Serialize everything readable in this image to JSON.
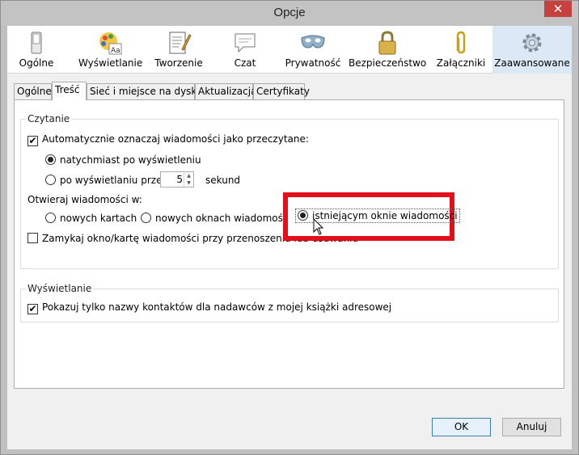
{
  "window": {
    "title": "Opcje",
    "close_glyph": "✕"
  },
  "toolbar": {
    "items": [
      {
        "label": "Ogólne",
        "icon": "switch-icon"
      },
      {
        "label": "Wyświetlanie",
        "icon": "palette-icon"
      },
      {
        "label": "Tworzenie",
        "icon": "compose-icon"
      },
      {
        "label": "Czat",
        "icon": "chat-bubble-icon"
      },
      {
        "label": "Prywatność",
        "icon": "mask-icon"
      },
      {
        "label": "Bezpieczeństwo",
        "icon": "padlock-icon"
      },
      {
        "label": "Załączniki",
        "icon": "paperclip-icon"
      },
      {
        "label": "Zaawansowane",
        "icon": "gear-icon"
      }
    ],
    "selected": "Zaawansowane"
  },
  "tabs": [
    "Ogólne",
    "Treść",
    "Sieć i miejsce na dysku",
    "Aktualizacja",
    "Certyfikaty"
  ],
  "active_tab": "Treść",
  "czytanie": {
    "title": "Czytanie",
    "auto_mark": {
      "label": "Automatycznie oznaczaj wiadomości jako przeczytane:",
      "checked": true
    },
    "immediately": {
      "label": "natychmiast po wyświetleniu",
      "selected": true
    },
    "after_display": {
      "label": "po wyświetlaniu przez",
      "selected": false
    },
    "seconds_value": "5",
    "seconds_unit": "sekund",
    "open_in": {
      "label": "Otwieraj wiadomości w:"
    },
    "new_tabs": {
      "label": "nowych kartach",
      "selected": false
    },
    "new_windows": {
      "label": "nowych oknach wiadomości",
      "selected": false
    },
    "existing_window": {
      "label": "istniejącym oknie wiadomości",
      "selected": true
    },
    "close_window": {
      "label": "Zamykaj okno/kartę wiadomości przy przenoszeniu lub usuwaniu",
      "checked": false
    }
  },
  "wyswietlanie": {
    "title": "Wyświetlanie",
    "show_names": {
      "label": "Pokazuj tylko nazwy kontaktów dla nadawców z mojej książki adresowej",
      "checked": true
    }
  },
  "buttons": {
    "ok": "OK",
    "cancel": "Anuluj"
  },
  "colors": {
    "highlight": "#e3101c",
    "selected_toolbar": "#dbe8f5"
  }
}
